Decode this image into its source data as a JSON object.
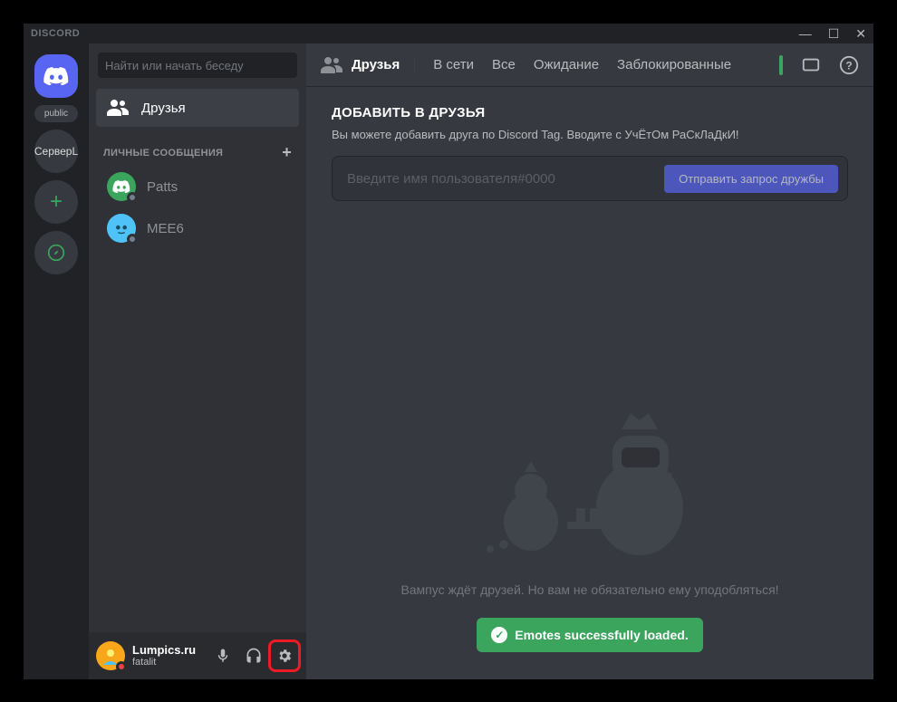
{
  "titlebar": {
    "title": "DISCORD"
  },
  "servers": {
    "folder_label": "public",
    "server1": "СерверL"
  },
  "search_placeholder": "Найти или начать беседу",
  "sidebar": {
    "friends_label": "Друзья",
    "dm_header": "ЛИЧНЫЕ СООБЩЕНИЯ",
    "dm": [
      {
        "name": "Patts",
        "color": "#3ba55d"
      },
      {
        "name": "MEE6",
        "color": "#4fc3f7"
      }
    ]
  },
  "user": {
    "name": "Lumpics.ru",
    "tag": "fatalit"
  },
  "topbar": {
    "friends": "Друзья",
    "tabs": {
      "online": "В сети",
      "all": "Все",
      "pending": "Ожидание",
      "blocked": "Заблокированные"
    }
  },
  "add_friend": {
    "title": "ДОБАВИТЬ В ДРУЗЬЯ",
    "subtitle": "Вы можете добавить друга по Discord Tag. Вводите с УчЁтОм РаСкЛаДкИ!",
    "placeholder": "Введите имя пользователя#0000",
    "button": "Отправить запрос дружбы"
  },
  "empty": {
    "text": "Вампус ждёт друзей. Но вам не обязательно ему уподобляться!"
  },
  "toast": {
    "text": "Emotes successfully loaded."
  }
}
